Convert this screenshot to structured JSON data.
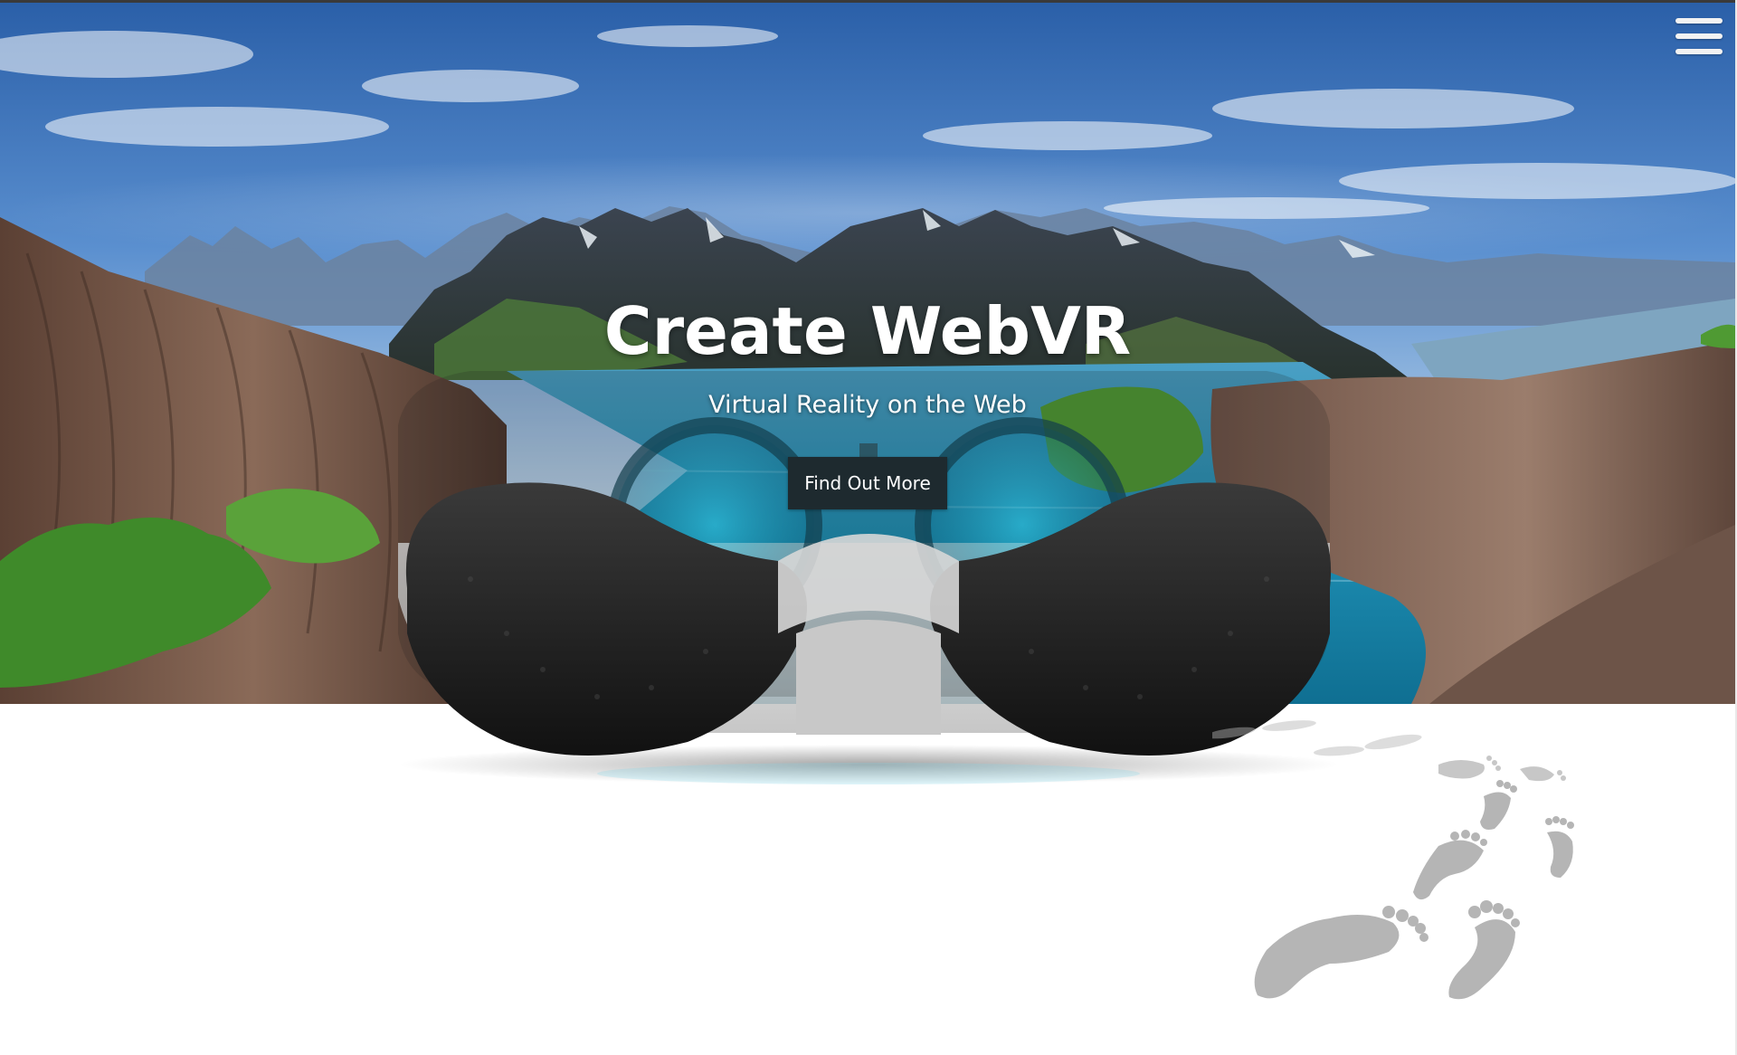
{
  "hero": {
    "title": "Create WebVR",
    "subtitle": "Virtual Reality on the Web",
    "cta_label": "Find Out More"
  },
  "nav": {
    "menu_icon": "hamburger-menu-icon"
  },
  "decor": {
    "footprints_icon": "footprints-icon",
    "headset_icon": "vr-headset-icon"
  },
  "colors": {
    "cta_background": "#1e2a2f",
    "title_text": "#ffffff",
    "page_background": "#ffffff"
  }
}
